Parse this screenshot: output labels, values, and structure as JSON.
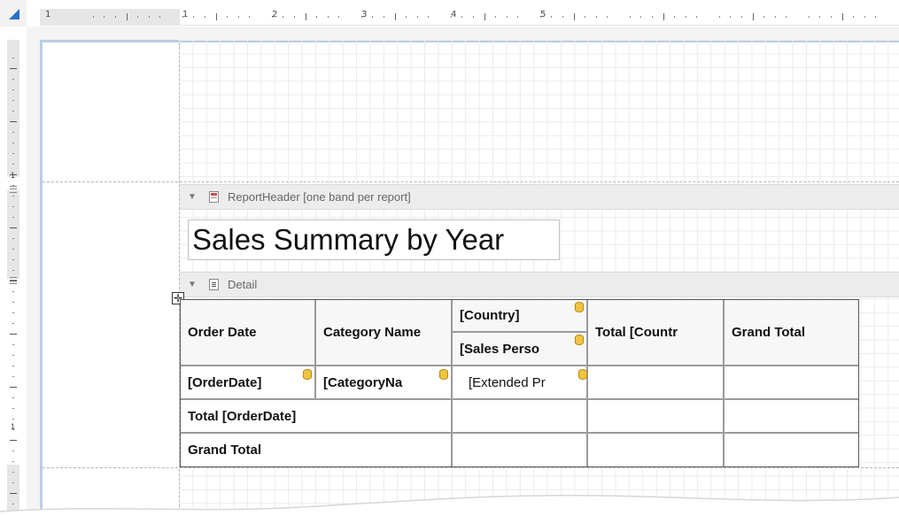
{
  "ruler": {
    "top_labels": [
      "1",
      "1",
      "2",
      "3",
      "4",
      "5"
    ],
    "left_labels": [
      "1",
      "1"
    ]
  },
  "bands": {
    "report_header": "ReportHeader [one band per report]",
    "detail": "Detail"
  },
  "title": "Sales Summary by Year",
  "cross_tab": {
    "header": {
      "order_date": "Order Date",
      "category_name": "Category Name",
      "country": "[Country]",
      "sales_person": "[Sales Perso",
      "total_country": "Total [Countr",
      "grand_total": "Grand Total"
    },
    "row": {
      "order_date_field": "[OrderDate]",
      "category_field": "[CategoryNa",
      "extended_price": "[Extended Pr"
    },
    "total_order_date": "Total [OrderDate]",
    "grand_total_row": "Grand Total"
  },
  "colors": {
    "accent": "#2a6fcf",
    "page_border": "#b9cde6",
    "band_bg": "#ececec",
    "field_icon": "#f0c341"
  },
  "icons": {
    "corner": "corner-triangle-icon",
    "report_header": "report-header-band-icon",
    "detail": "detail-band-icon",
    "move": "move-handle-icon",
    "field": "database-field-icon"
  }
}
